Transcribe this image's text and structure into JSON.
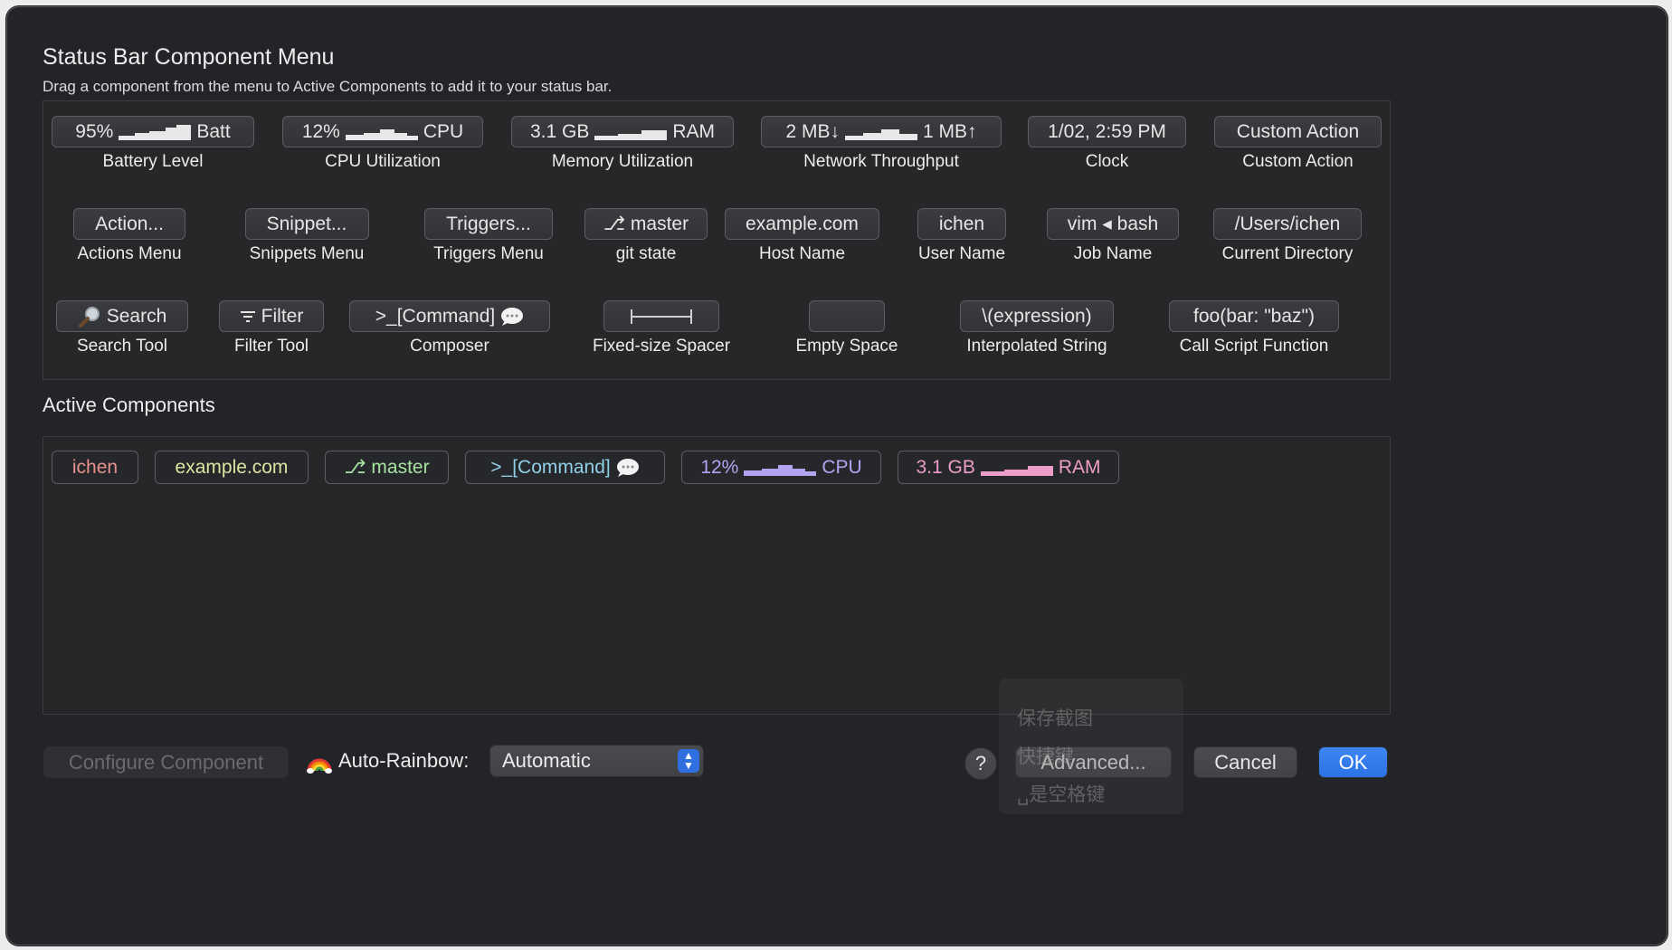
{
  "window": {
    "title": "Status Bar Component Menu",
    "subtitle": "Drag a component from the menu to Active Components to add it to your status bar."
  },
  "menu": {
    "row1": [
      {
        "pill_left": "95%",
        "pill_right": "Batt",
        "caption": "Battery Level"
      },
      {
        "pill_left": "12%",
        "pill_right": "CPU",
        "caption": "CPU Utilization"
      },
      {
        "pill_left": "3.1 GB",
        "pill_right": "RAM",
        "caption": "Memory Utilization"
      },
      {
        "pill_left": "2 MB↓",
        "pill_right": "1 MB↑",
        "caption": "Network Throughput"
      },
      {
        "pill": "1/02, 2:59 PM",
        "caption": "Clock"
      },
      {
        "pill": "Custom Action",
        "caption": "Custom Action"
      }
    ],
    "row2": [
      {
        "pill": "Action...",
        "caption": "Actions Menu"
      },
      {
        "pill": "Snippet...",
        "caption": "Snippets Menu"
      },
      {
        "pill": "Triggers...",
        "caption": "Triggers Menu"
      },
      {
        "pill": "⎇ master",
        "caption": "git state"
      },
      {
        "pill": "example.com",
        "caption": "Host Name"
      },
      {
        "pill": "ichen",
        "caption": "User Name"
      },
      {
        "pill": "vim ◂ bash",
        "caption": "Job Name"
      },
      {
        "pill": "/Users/ichen",
        "caption": "Current Directory"
      }
    ],
    "row3": [
      {
        "pill": "Search",
        "caption": "Search Tool",
        "icon": "magnifier-icon"
      },
      {
        "pill": "Filter",
        "caption": "Filter Tool",
        "icon": "filter-icon"
      },
      {
        "pill": ">_[Command]",
        "caption": "Composer",
        "icon": "speech-bubble-icon"
      },
      {
        "pill": "",
        "caption": "Fixed-size Spacer",
        "icon": "spacer-bracket-icon"
      },
      {
        "pill": "",
        "caption": "Empty Space"
      },
      {
        "pill": "\\(expression)",
        "caption": "Interpolated String"
      },
      {
        "pill": "foo(bar: \"baz\")",
        "caption": "Call Script Function"
      }
    ]
  },
  "active": {
    "title": "Active Components",
    "items": [
      {
        "text": "ichen",
        "color": "#e8918b"
      },
      {
        "text": "example.com",
        "color": "#dfe3a0"
      },
      {
        "text": "⎇ master",
        "color": "#a7e3a0"
      },
      {
        "text": ">_[Command]",
        "color": "#8fd0e8"
      },
      {
        "text_left": "12%",
        "text_right": "CPU",
        "color": "#b3a3f0"
      },
      {
        "text_left": "3.1 GB",
        "text_right": "RAM",
        "color": "#ec9ec9"
      }
    ]
  },
  "footer": {
    "configure_label": "Configure Component",
    "rainbow_label": "Auto-Rainbow:",
    "rainbow_value": "Automatic",
    "help_label": "?",
    "advanced_label": "Advanced...",
    "cancel_label": "Cancel",
    "ok_label": "OK"
  },
  "overlay": {
    "line1": "保存截图",
    "line2": "快捷键",
    "line3": "␣是空格键"
  },
  "colors": {
    "accent": "#2f78ea",
    "window_bg": "#232427"
  }
}
